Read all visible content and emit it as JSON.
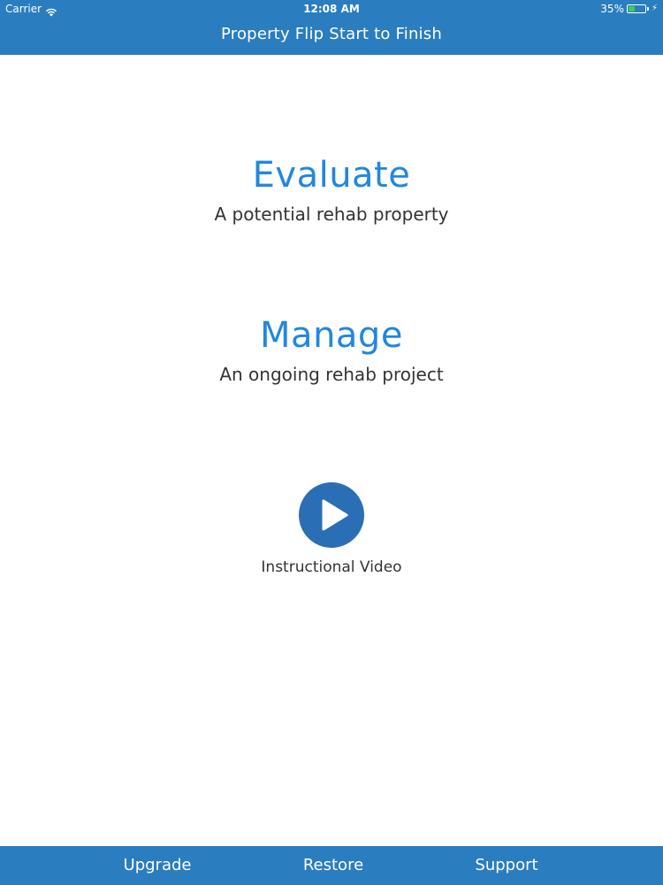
{
  "status_bar": {
    "carrier": "Carrier",
    "time": "12:08 AM",
    "battery_percent": "35%",
    "battery_level": 0.35,
    "battery_color": "#3ccf4e"
  },
  "nav": {
    "title": "Property Flip Start to Finish",
    "background_color": "#2a7dbf"
  },
  "options": [
    {
      "title": "Evaluate",
      "subtitle": "A potential rehab property"
    },
    {
      "title": "Manage",
      "subtitle": "An ongoing rehab project"
    }
  ],
  "video": {
    "icon": "play-icon",
    "label": "Instructional Video"
  },
  "bottom_bar": {
    "items": [
      {
        "label": "Upgrade"
      },
      {
        "label": "Restore"
      },
      {
        "label": "Support"
      }
    ]
  },
  "colors": {
    "accent": "#2187e0",
    "bar": "#2a7dbf",
    "play_button": "#2a6fb5"
  }
}
